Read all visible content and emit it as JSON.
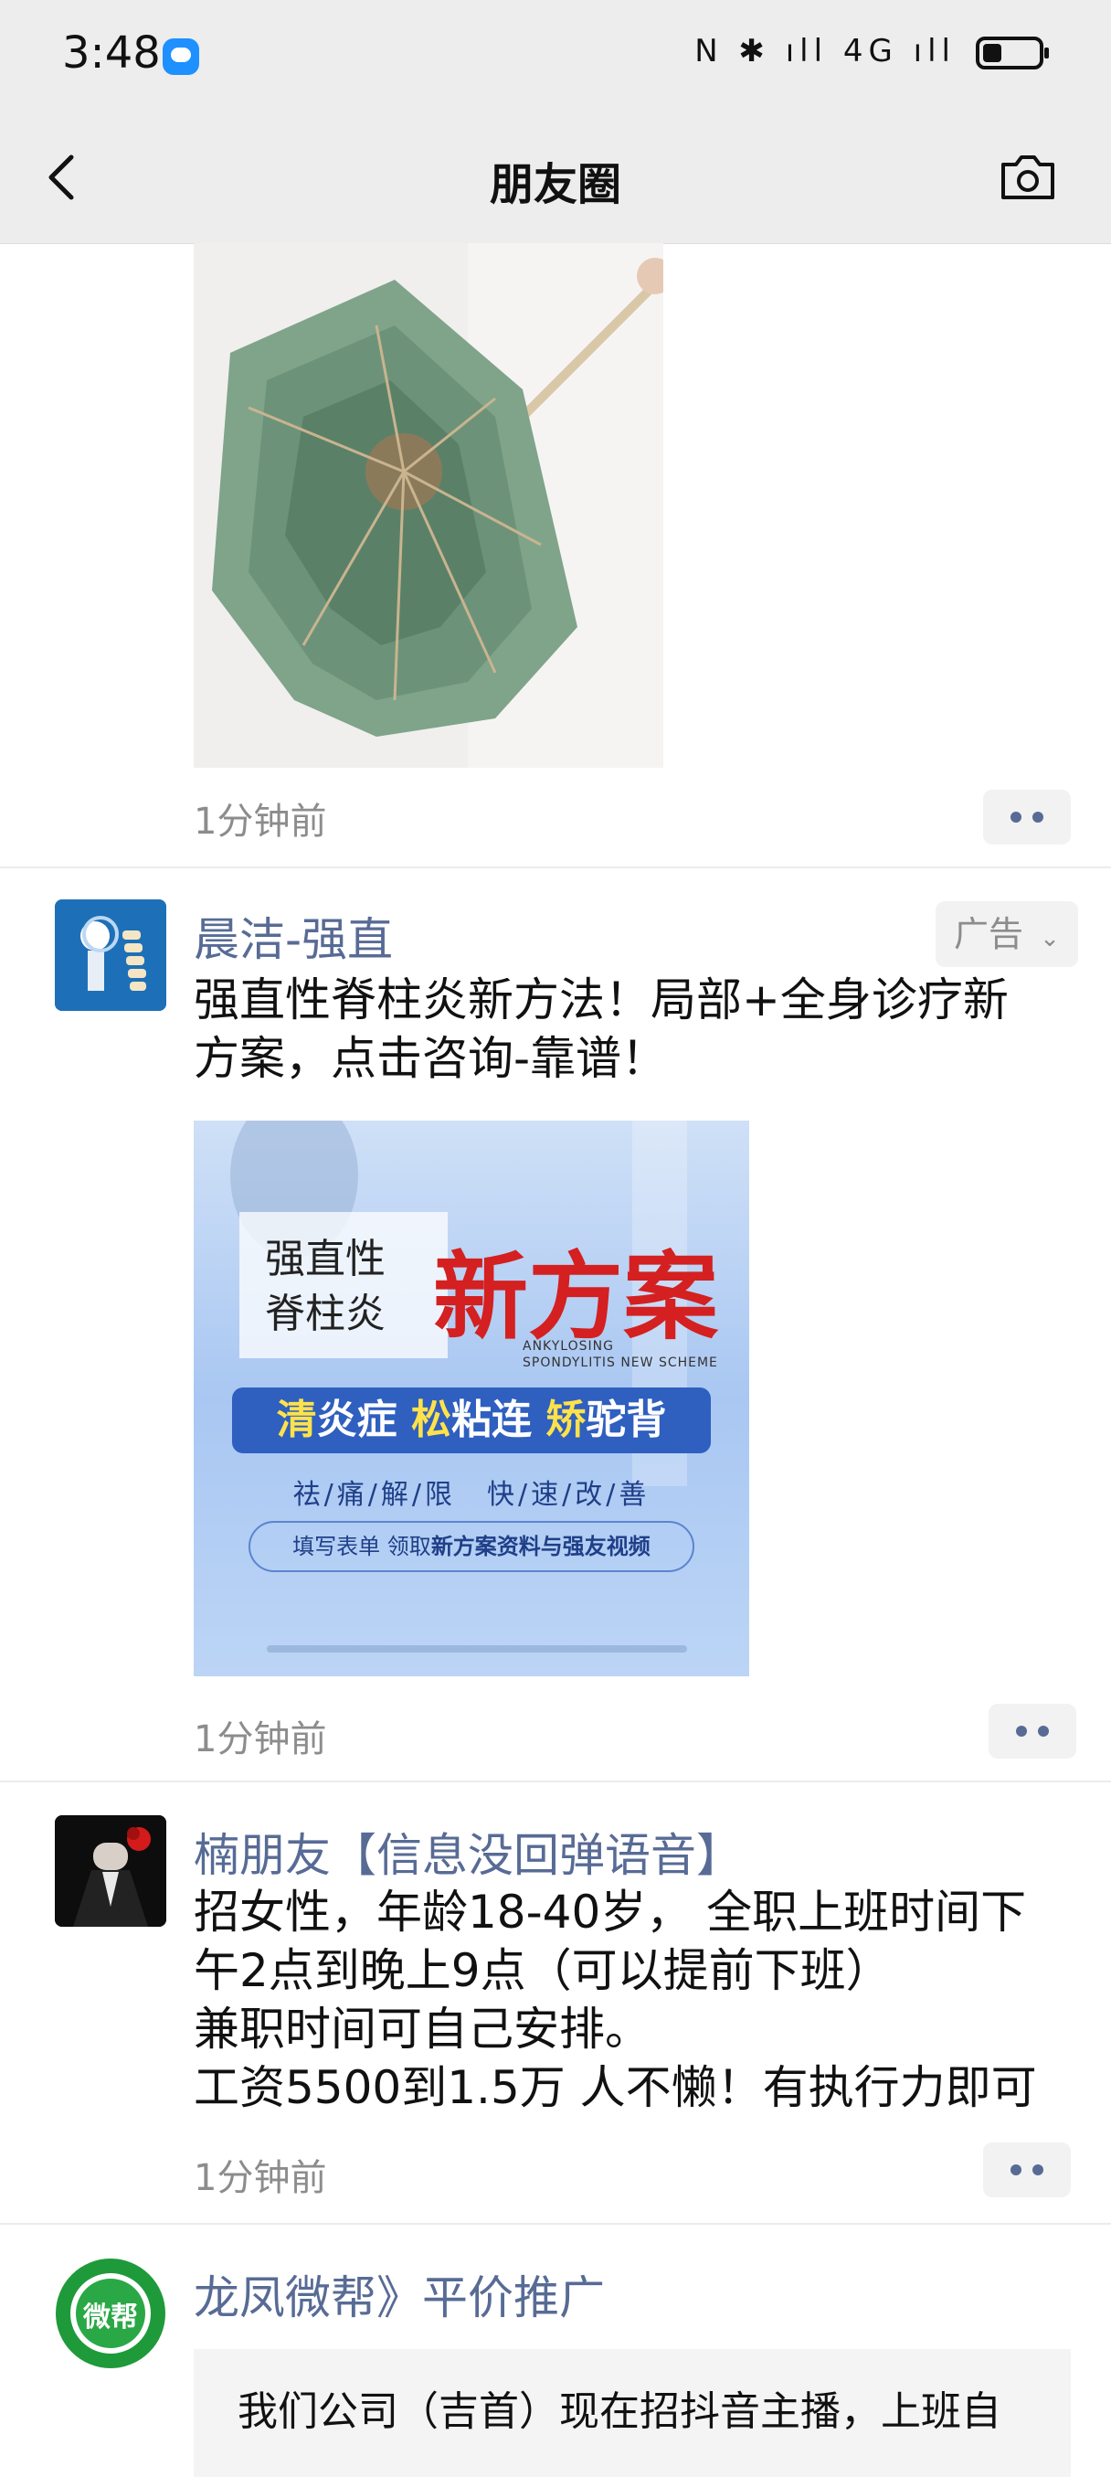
{
  "status_bar": {
    "time": "3:48",
    "icons": "N ✱ ıll 4G ıll"
  },
  "nav": {
    "title": "朋友圈"
  },
  "posts": [
    {
      "time": "1分钟前"
    },
    {
      "nickname": "晨洁-强直",
      "ad_label": "广告",
      "text_lines": [
        "强直性脊柱炎新方法！局部+全身诊疗新",
        "方案，点击咨询-靠谱！"
      ],
      "ad_image": {
        "small_lines": [
          "强直性",
          "脊柱炎"
        ],
        "big": "新方案",
        "english_lines": [
          "ANKYLOSING",
          "SPONDYLITIS NEW SCHEME"
        ],
        "bar_parts": [
          "清",
          "炎症 ",
          "松",
          "粘连 ",
          "矫",
          "驼背"
        ],
        "sub": "祛/痛/解/限　快/速/改/善",
        "pill_prefix": "填写表单 领取",
        "pill_bold": "新方案资料与强友视频"
      },
      "time": "1分钟前"
    },
    {
      "nickname": "楠朋友【信息没回弹语音】",
      "text_lines": [
        "招女性，年龄18-40岁， 全职上班时间下",
        "午2点到晚上9点（可以提前下班）",
        "兼职时间可自己安排。",
        "工资5500到1.5万  人不懒！有执行力即可"
      ],
      "time": "1分钟前"
    },
    {
      "nickname": "龙凤微帮》平价推广",
      "avatar_text": "微帮",
      "card_text": "我们公司（吉首）现在招抖音主播，上班自"
    }
  ]
}
